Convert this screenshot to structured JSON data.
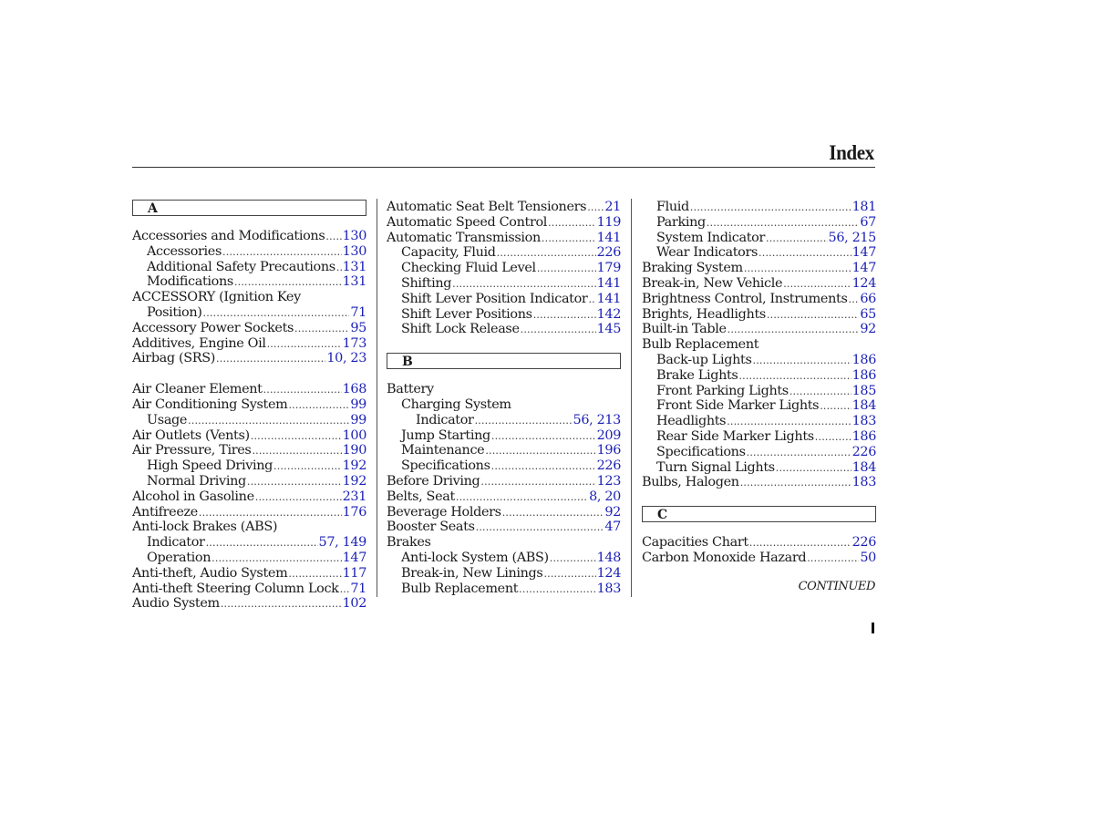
{
  "header": {
    "title": "Index"
  },
  "columns": [
    {
      "blocks": [
        {
          "type": "section",
          "letter": "A"
        },
        {
          "type": "entry",
          "level": 0,
          "label": "Accessories and Modifications",
          "page": "130"
        },
        {
          "type": "entry",
          "level": 1,
          "label": "Accessories",
          "page": "130"
        },
        {
          "type": "entry",
          "level": 1,
          "label": "Additional Safety Precautions",
          "page": "131"
        },
        {
          "type": "entry",
          "level": 1,
          "label": "Modifications",
          "page": "131"
        },
        {
          "type": "entry",
          "level": 0,
          "label": "ACCESSORY (Ignition Key",
          "page": ""
        },
        {
          "type": "entry",
          "level": 1,
          "label": "Position)",
          "page": "71"
        },
        {
          "type": "entry",
          "level": 0,
          "label": "Accessory Power Sockets",
          "page": "95"
        },
        {
          "type": "entry",
          "level": 0,
          "label": "Additives, Engine Oil",
          "page": "173"
        },
        {
          "type": "entry",
          "level": 0,
          "label": "Airbag (SRS)",
          "page": "10, 23"
        },
        {
          "type": "spacer"
        },
        {
          "type": "entry",
          "level": 0,
          "label": "Air Cleaner Element",
          "page": "168"
        },
        {
          "type": "entry",
          "level": 0,
          "label": "Air Conditioning System",
          "page": "99"
        },
        {
          "type": "entry",
          "level": 1,
          "label": "Usage",
          "page": "99"
        },
        {
          "type": "entry",
          "level": 0,
          "label": "Air Outlets (Vents)",
          "page": "100"
        },
        {
          "type": "entry",
          "level": 0,
          "label": "Air Pressure, Tires",
          "page": "190"
        },
        {
          "type": "entry",
          "level": 1,
          "label": "High Speed Driving",
          "page": "192"
        },
        {
          "type": "entry",
          "level": 1,
          "label": "Normal Driving",
          "page": "192"
        },
        {
          "type": "entry",
          "level": 0,
          "label": "Alcohol in Gasoline",
          "page": "231"
        },
        {
          "type": "entry",
          "level": 0,
          "label": "Antifreeze",
          "page": "176"
        },
        {
          "type": "entry",
          "level": 0,
          "label": "Anti-lock Brakes (ABS)",
          "page": ""
        },
        {
          "type": "entry",
          "level": 1,
          "label": "Indicator",
          "page": "57, 149"
        },
        {
          "type": "entry",
          "level": 1,
          "label": "Operation",
          "page": "147"
        },
        {
          "type": "entry",
          "level": 0,
          "label": "Anti-theft, Audio System",
          "page": "117"
        },
        {
          "type": "entry",
          "level": 0,
          "label": "Anti-theft Steering Column Lock",
          "page": "71"
        },
        {
          "type": "entry",
          "level": 0,
          "label": "Audio System",
          "page": "102"
        }
      ]
    },
    {
      "blocks": [
        {
          "type": "entry",
          "level": 0,
          "label": "Automatic Seat Belt Tensioners",
          "page": "21"
        },
        {
          "type": "entry",
          "level": 0,
          "label": "Automatic Speed Control",
          "page": "119"
        },
        {
          "type": "entry",
          "level": 0,
          "label": "Automatic Transmission",
          "page": "141"
        },
        {
          "type": "entry",
          "level": 1,
          "label": "Capacity, Fluid",
          "page": "226"
        },
        {
          "type": "entry",
          "level": 1,
          "label": "Checking Fluid Level",
          "page": "179"
        },
        {
          "type": "entry",
          "level": 1,
          "label": "Shifting",
          "page": "141"
        },
        {
          "type": "entry",
          "level": 1,
          "label": "Shift Lever Position Indicator",
          "page": "141"
        },
        {
          "type": "entry",
          "level": 1,
          "label": "Shift Lever Positions",
          "page": "142"
        },
        {
          "type": "entry",
          "level": 1,
          "label": "Shift Lock Release",
          "page": "145"
        },
        {
          "type": "spacer"
        },
        {
          "type": "section",
          "letter": "B"
        },
        {
          "type": "entry",
          "level": 0,
          "label": "Battery",
          "page": ""
        },
        {
          "type": "entry",
          "level": 1,
          "label": "Charging System",
          "page": ""
        },
        {
          "type": "entry",
          "level": 2,
          "label": "Indicator",
          "page": "56, 213"
        },
        {
          "type": "entry",
          "level": 1,
          "label": "Jump Starting",
          "page": "209"
        },
        {
          "type": "entry",
          "level": 1,
          "label": "Maintenance",
          "page": "196"
        },
        {
          "type": "entry",
          "level": 1,
          "label": "Specifications",
          "page": "226"
        },
        {
          "type": "entry",
          "level": 0,
          "label": "Before Driving",
          "page": "123"
        },
        {
          "type": "entry",
          "level": 0,
          "label": "Belts, Seat",
          "page": "8, 20"
        },
        {
          "type": "entry",
          "level": 0,
          "label": "Beverage Holders",
          "page": "92"
        },
        {
          "type": "entry",
          "level": 0,
          "label": "Booster Seats",
          "page": "47"
        },
        {
          "type": "entry",
          "level": 0,
          "label": "Brakes",
          "page": ""
        },
        {
          "type": "entry",
          "level": 1,
          "label": "Anti-lock System (ABS)",
          "page": "148"
        },
        {
          "type": "entry",
          "level": 1,
          "label": "Break-in, New Linings",
          "page": "124"
        },
        {
          "type": "entry",
          "level": 1,
          "label": "Bulb Replacement",
          "page": "183"
        }
      ]
    },
    {
      "blocks": [
        {
          "type": "entry",
          "level": 1,
          "label": "Fluid",
          "page": "181"
        },
        {
          "type": "entry",
          "level": 1,
          "label": "Parking",
          "page": "67"
        },
        {
          "type": "entry",
          "level": 1,
          "label": "System Indicator",
          "page": "56, 215"
        },
        {
          "type": "entry",
          "level": 1,
          "label": "Wear Indicators",
          "page": "147"
        },
        {
          "type": "entry",
          "level": 0,
          "label": "Braking System",
          "page": "147"
        },
        {
          "type": "entry",
          "level": 0,
          "label": "Break-in, New Vehicle",
          "page": "124"
        },
        {
          "type": "entry",
          "level": 0,
          "label": "Brightness Control, Instruments",
          "page": "66"
        },
        {
          "type": "entry",
          "level": 0,
          "label": "Brights, Headlights",
          "page": "65"
        },
        {
          "type": "entry",
          "level": 0,
          "label": "Built-in Table",
          "page": "92"
        },
        {
          "type": "entry",
          "level": 0,
          "label": "Bulb Replacement",
          "page": ""
        },
        {
          "type": "entry",
          "level": 1,
          "label": "Back-up Lights",
          "page": "186"
        },
        {
          "type": "entry",
          "level": 1,
          "label": "Brake Lights",
          "page": "186"
        },
        {
          "type": "entry",
          "level": 1,
          "label": "Front Parking Lights",
          "page": "185"
        },
        {
          "type": "entry",
          "level": 1,
          "label": "Front Side Marker Lights",
          "page": "184"
        },
        {
          "type": "entry",
          "level": 1,
          "label": "Headlights",
          "page": "183"
        },
        {
          "type": "entry",
          "level": 1,
          "label": "Rear Side Marker Lights",
          "page": "186"
        },
        {
          "type": "entry",
          "level": 1,
          "label": "Specifications",
          "page": "226"
        },
        {
          "type": "entry",
          "level": 1,
          "label": "Turn Signal Lights",
          "page": "184"
        },
        {
          "type": "entry",
          "level": 0,
          "label": "Bulbs, Halogen",
          "page": "183"
        },
        {
          "type": "spacer"
        },
        {
          "type": "section",
          "letter": "C"
        },
        {
          "type": "entry",
          "level": 0,
          "label": "Capacities Chart",
          "page": "226"
        },
        {
          "type": "entry",
          "level": 0,
          "label": "Carbon Monoxide Hazard",
          "page": "50"
        }
      ]
    }
  ],
  "footer": {
    "continued": "CONTINUED"
  },
  "colors": {
    "page_number_link": "#1a1fb5",
    "text": "#1a1a1a"
  }
}
